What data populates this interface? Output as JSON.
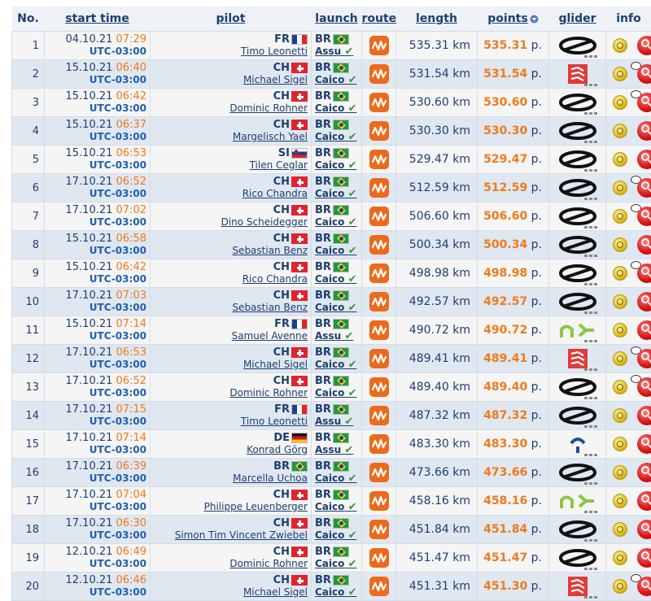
{
  "headers": {
    "no": "No.",
    "start_time": "start time",
    "pilot": "pilot",
    "launch": "launch",
    "route": "route",
    "length": "length",
    "points": "points",
    "glider": "glider",
    "info": "info"
  },
  "units": {
    "length": "km",
    "points": "p."
  },
  "rows": [
    {
      "no": "1",
      "date": "04.10.21",
      "time": "07:29",
      "tz": "UTC-03:00",
      "country": "FR",
      "flag": "fr",
      "name": "Timo Leonetti",
      "lcountry": "BR",
      "site": "Assu",
      "length": "535.31",
      "points": "535.31",
      "glider": "ozone",
      "comment": false,
      "photo": false
    },
    {
      "no": "2",
      "date": "15.10.21",
      "time": "06:40",
      "tz": "UTC-03:00",
      "country": "CH",
      "flag": "ch",
      "name": "Michael Sigel",
      "lcountry": "BR",
      "site": "Caico",
      "length": "531.54",
      "points": "531.54",
      "glider": "gin",
      "comment": true,
      "photo": false
    },
    {
      "no": "3",
      "date": "15.10.21",
      "time": "06:42",
      "tz": "UTC-03:00",
      "country": "CH",
      "flag": "ch",
      "name": "Dominic Rohner",
      "lcountry": "BR",
      "site": "Caico",
      "length": "530.60",
      "points": "530.60",
      "glider": "ozone",
      "comment": true,
      "photo": false
    },
    {
      "no": "4",
      "date": "15.10.21",
      "time": "06:37",
      "tz": "UTC-03:00",
      "country": "CH",
      "flag": "ch",
      "name": "Margelisch Yael",
      "lcountry": "BR",
      "site": "Caico",
      "length": "530.30",
      "points": "530.30",
      "glider": "ozone",
      "comment": false,
      "photo": false
    },
    {
      "no": "5",
      "date": "15.10.21",
      "time": "06:53",
      "tz": "UTC-03:00",
      "country": "SI",
      "flag": "si",
      "name": "Tilen Ceglar",
      "lcountry": "BR",
      "site": "Caico",
      "length": "529.47",
      "points": "529.47",
      "glider": "ozone",
      "comment": false,
      "photo": true
    },
    {
      "no": "6",
      "date": "17.10.21",
      "time": "06:52",
      "tz": "UTC-03:00",
      "country": "CH",
      "flag": "ch",
      "name": "Rico Chandra",
      "lcountry": "BR",
      "site": "Caico",
      "length": "512.59",
      "points": "512.59",
      "glider": "ozone",
      "comment": true,
      "photo": false
    },
    {
      "no": "7",
      "date": "17.10.21",
      "time": "07:02",
      "tz": "UTC-03:00",
      "country": "CH",
      "flag": "ch",
      "name": "Dino Scheidegger",
      "lcountry": "BR",
      "site": "Caico",
      "length": "506.60",
      "points": "506.60",
      "glider": "ozone",
      "comment": true,
      "photo": true
    },
    {
      "no": "8",
      "date": "15.10.21",
      "time": "06:58",
      "tz": "UTC-03:00",
      "country": "CH",
      "flag": "ch",
      "name": "Sebastian Benz",
      "lcountry": "BR",
      "site": "Caico",
      "length": "500.34",
      "points": "500.34",
      "glider": "ozone",
      "comment": false,
      "photo": false
    },
    {
      "no": "9",
      "date": "15.10.21",
      "time": "06:42",
      "tz": "UTC-03:00",
      "country": "CH",
      "flag": "ch",
      "name": "Rico Chandra",
      "lcountry": "BR",
      "site": "Caico",
      "length": "498.98",
      "points": "498.98",
      "glider": "ozone",
      "comment": true,
      "photo": false
    },
    {
      "no": "10",
      "date": "17.10.21",
      "time": "07:03",
      "tz": "UTC-03:00",
      "country": "CH",
      "flag": "ch",
      "name": "Sebastian Benz",
      "lcountry": "BR",
      "site": "Caico",
      "length": "492.57",
      "points": "492.57",
      "glider": "ozone",
      "comment": false,
      "photo": false
    },
    {
      "no": "11",
      "date": "15.10.21",
      "time": "07:14",
      "tz": "UTC-03:00",
      "country": "FR",
      "flag": "fr",
      "name": "Samuel Avenne",
      "lcountry": "BR",
      "site": "Assu",
      "length": "490.72",
      "points": "490.72",
      "glider": "niviuk",
      "comment": false,
      "photo": false
    },
    {
      "no": "12",
      "date": "17.10.21",
      "time": "06:53",
      "tz": "UTC-03:00",
      "country": "CH",
      "flag": "ch",
      "name": "Michael Sigel",
      "lcountry": "BR",
      "site": "Caico",
      "length": "489.41",
      "points": "489.41",
      "glider": "gin",
      "comment": true,
      "photo": true
    },
    {
      "no": "13",
      "date": "17.10.21",
      "time": "06:52",
      "tz": "UTC-03:00",
      "country": "CH",
      "flag": "ch",
      "name": "Dominic Rohner",
      "lcountry": "BR",
      "site": "Caico",
      "length": "489.40",
      "points": "489.40",
      "glider": "ozone",
      "comment": true,
      "photo": false
    },
    {
      "no": "14",
      "date": "17.10.21",
      "time": "07:15",
      "tz": "UTC-03:00",
      "country": "FR",
      "flag": "fr",
      "name": "Timo Leonetti",
      "lcountry": "BR",
      "site": "Assu",
      "length": "487.32",
      "points": "487.32",
      "glider": "ozone",
      "comment": false,
      "photo": false
    },
    {
      "no": "15",
      "date": "17.10.21",
      "time": "07:14",
      "tz": "UTC-03:00",
      "country": "DE",
      "flag": "de",
      "name": "Konrad Görg",
      "lcountry": "BR",
      "site": "Assu",
      "length": "483.30",
      "points": "483.30",
      "glider": "skywalk",
      "comment": false,
      "photo": false
    },
    {
      "no": "16",
      "date": "17.10.21",
      "time": "06:39",
      "tz": "UTC-03:00",
      "country": "BR",
      "flag": "br",
      "name": "Marcella Uchoa",
      "lcountry": "BR",
      "site": "Caico",
      "length": "473.66",
      "points": "473.66",
      "glider": "ozone",
      "comment": false,
      "photo": false
    },
    {
      "no": "17",
      "date": "17.10.21",
      "time": "07:04",
      "tz": "UTC-03:00",
      "country": "CH",
      "flag": "ch",
      "name": "Philippe Leuenberger",
      "lcountry": "BR",
      "site": "Caico",
      "length": "458.16",
      "points": "458.16",
      "glider": "niviuk",
      "comment": false,
      "photo": false
    },
    {
      "no": "18",
      "date": "17.10.21",
      "time": "06:30",
      "tz": "UTC-03:00",
      "country": "CH",
      "flag": "ch",
      "name": "Simon Tim Vincent Zwiebel",
      "lcountry": "BR",
      "site": "Caico",
      "length": "451.84",
      "points": "451.84",
      "glider": "ozone",
      "comment": false,
      "photo": false
    },
    {
      "no": "19",
      "date": "12.10.21",
      "time": "06:49",
      "tz": "UTC-03:00",
      "country": "CH",
      "flag": "ch",
      "name": "Dominic Rohner",
      "lcountry": "BR",
      "site": "Caico",
      "length": "451.47",
      "points": "451.47",
      "glider": "ozone",
      "comment": false,
      "photo": false
    },
    {
      "no": "20",
      "date": "12.10.21",
      "time": "06:46",
      "tz": "UTC-03:00",
      "country": "CH",
      "flag": "ch",
      "name": "Michael Sigel",
      "lcountry": "BR",
      "site": "Caico",
      "length": "451.31",
      "points": "451.30",
      "glider": "gin",
      "comment": true,
      "photo": false
    }
  ]
}
